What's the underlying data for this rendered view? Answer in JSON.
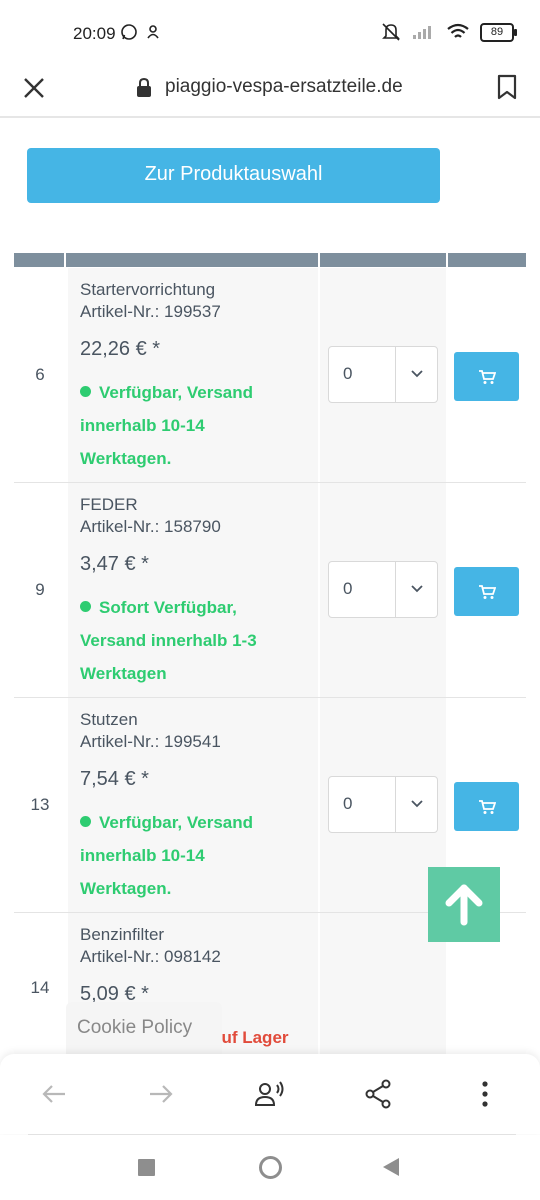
{
  "status_bar": {
    "time": "20:09",
    "battery": "89"
  },
  "url_bar": {
    "domain": "piaggio-vespa-ersatzteile.de"
  },
  "product_selection_button": "Zur Produktauswahl",
  "rows": [
    {
      "pos": "6",
      "name": "Startervorrichtung",
      "article": "Artikel-Nr.: 199537",
      "price": "22,26 € *",
      "availability": "Verfügbar, Versand innerhalb 10-14 Werktagen.",
      "available": true,
      "qty": "0"
    },
    {
      "pos": "9",
      "name": "FEDER",
      "article": "Artikel-Nr.: 158790",
      "price": "3,47 € *",
      "availability": "Sofort Verfügbar, Versand innerhalb 1-3 Werktagen",
      "available": true,
      "qty": "0"
    },
    {
      "pos": "13",
      "name": "Stutzen",
      "article": "Artikel-Nr.: 199541",
      "price": "7,54 € *",
      "availability": "Verfügbar, Versand innerhalb 10-14 Werktagen.",
      "available": true,
      "qty": "0"
    },
    {
      "pos": "14",
      "name": "Benzinfilter",
      "article": "Artikel-Nr.: 098142",
      "price": "5,09 € *",
      "availability": "auf Lager",
      "available": false
    }
  ],
  "cookie_policy": "Cookie Policy",
  "colors": {
    "accent": "#45b5e5",
    "available": "#2ecc71",
    "unavailable": "#e14b3b",
    "scroll_top": "#5fcaa4",
    "table_header": "#7e8f9d"
  },
  "icons": {
    "close": "close-icon",
    "lock": "lock-icon",
    "bookmark": "bookmark-icon",
    "cart": "cart-icon",
    "scroll_top": "arrow-up-icon",
    "back": "arrow-left-icon",
    "forward": "arrow-right-icon",
    "read_aloud": "voice-icon",
    "share": "share-icon",
    "menu": "more-vertical-icon"
  }
}
